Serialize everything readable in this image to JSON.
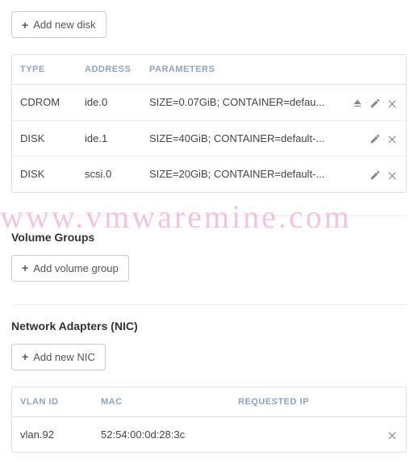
{
  "disks": {
    "addBtn": "Add new disk",
    "headers": {
      "type": "TYPE",
      "address": "ADDRESS",
      "parameters": "PARAMETERS"
    },
    "rows": [
      {
        "type": "CDROM",
        "address": "ide.0",
        "parameters": "SIZE=0.07GiB; CONTAINER=defau...",
        "eject": true
      },
      {
        "type": "DISK",
        "address": "ide.1",
        "parameters": "SIZE=40GiB; CONTAINER=default-...",
        "eject": false
      },
      {
        "type": "DISK",
        "address": "scsi.0",
        "parameters": "SIZE=20GiB; CONTAINER=default-...",
        "eject": false
      }
    ]
  },
  "volumeGroups": {
    "title": "Volume Groups",
    "addBtn": "Add volume group"
  },
  "nics": {
    "title": "Network Adapters (NIC)",
    "addBtn": "Add new NIC",
    "headers": {
      "vlan": "VLAN ID",
      "mac": "MAC",
      "ip": "REQUESTED IP"
    },
    "rows": [
      {
        "vlan": "vlan.92",
        "mac": "52:54:00:0d:28:3c",
        "ip": ""
      }
    ]
  },
  "watermark": "www.vmwaremine.com"
}
